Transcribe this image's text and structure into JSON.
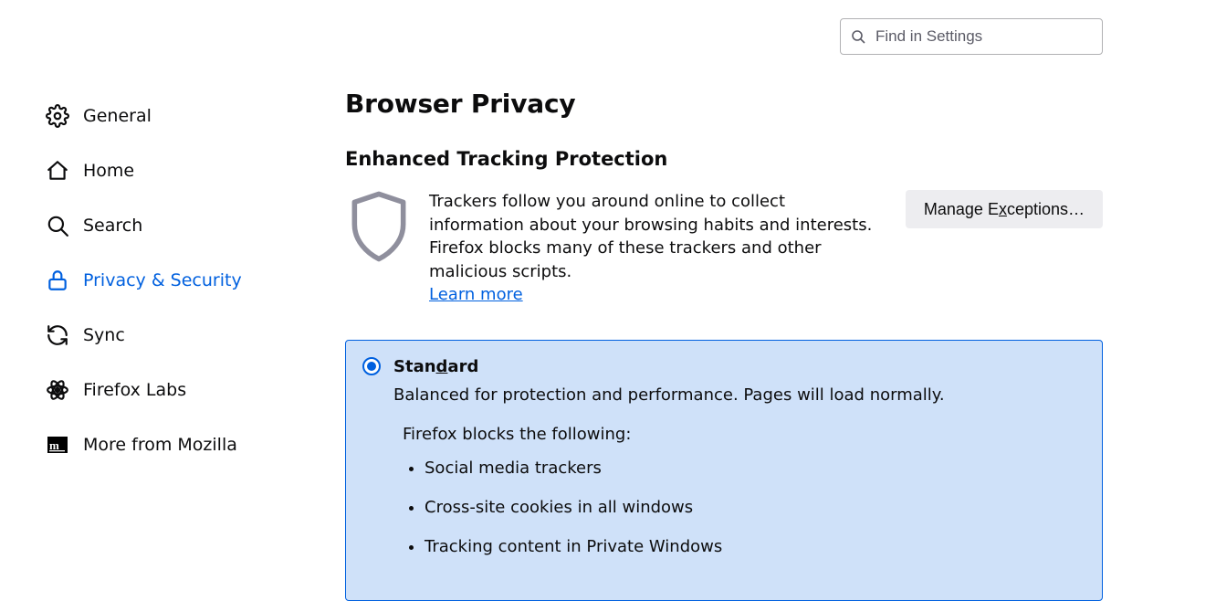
{
  "search": {
    "placeholder": "Find in Settings"
  },
  "sidebar": {
    "items": [
      {
        "label": "General"
      },
      {
        "label": "Home"
      },
      {
        "label": "Search"
      },
      {
        "label": "Privacy & Security"
      },
      {
        "label": "Sync"
      },
      {
        "label": "Firefox Labs"
      },
      {
        "label": "More from Mozilla"
      }
    ]
  },
  "main": {
    "title": "Browser Privacy",
    "section_title": "Enhanced Tracking Protection",
    "etp_desc": "Trackers follow you around online to collect information about your browsing habits and interests. Firefox blocks many of these trackers and other malicious scripts.",
    "learn_more": "Learn more",
    "manage_pre": "Manage E",
    "manage_key": "x",
    "manage_post": "ceptions…",
    "standard": {
      "label_pre": "Stan",
      "label_key": "d",
      "label_post": "ard",
      "desc": "Balanced for protection and performance. Pages will load normally.",
      "blocks_heading": "Firefox blocks the following:",
      "items": [
        "Social media trackers",
        "Cross-site cookies in all windows",
        "Tracking content in Private Windows"
      ]
    }
  }
}
